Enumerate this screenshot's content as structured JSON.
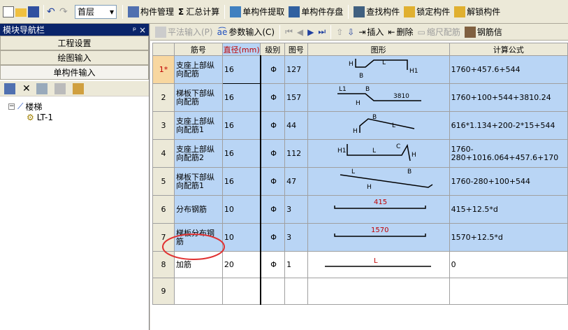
{
  "toolbar": {
    "floor": "首层",
    "items": [
      "构件管理",
      "汇总计算",
      "单构件提取",
      "单构件存盘",
      "查找构件",
      "锁定构件",
      "解锁构件"
    ]
  },
  "nav": {
    "title": "模块导航栏",
    "pin": "ᵖ × ",
    "sections": [
      "工程设置",
      "绘图输入",
      "单构件输入"
    ],
    "tree": {
      "root": "楼梯",
      "child": "LT-1"
    }
  },
  "toolbar2": {
    "items": [
      "平法输入(P)",
      "参数输入(C)",
      "插入",
      "删除",
      "缩尺配筋",
      "钢筋信"
    ]
  },
  "table": {
    "headers": [
      "",
      "筋号",
      "直径(mm)",
      "级别",
      "图号",
      "图形",
      "计算公式"
    ],
    "rows": [
      {
        "rn": "1*",
        "name": "支座上部纵向配筋",
        "diam": "16",
        "grade": "Φ",
        "fig": "127",
        "formula": "1760+457.6+544"
      },
      {
        "rn": "2",
        "name": "梯板下部纵向配筋",
        "diam": "16",
        "grade": "Φ",
        "fig": "157",
        "formula": "1760+100+544+3810.24"
      },
      {
        "rn": "3",
        "name": "支座上部纵向配筋1",
        "diam": "16",
        "grade": "Φ",
        "fig": "44",
        "formula": "616*1.134+200-2*15+544"
      },
      {
        "rn": "4",
        "name": "支座上部纵向配筋2",
        "diam": "16",
        "grade": "Φ",
        "fig": "112",
        "formula": "1760-280+1016.064+457.6+170"
      },
      {
        "rn": "5",
        "name": "梯板下部纵向配筋1",
        "diam": "16",
        "grade": "Φ",
        "fig": "47",
        "formula": "1760-280+100+544"
      },
      {
        "rn": "6",
        "name": "分布钢筋",
        "diam": "10",
        "grade": "Φ",
        "fig": "3",
        "formula": "415+12.5*d"
      },
      {
        "rn": "7",
        "name": "梯板分布钢筋",
        "diam": "10",
        "grade": "Φ",
        "fig": "3",
        "formula": "1570+12.5*d"
      },
      {
        "rn": "8",
        "name": "加筋",
        "diam": "20",
        "grade": "Φ",
        "fig": "1",
        "formula": "0"
      },
      {
        "rn": "9",
        "name": "",
        "diam": "",
        "grade": "",
        "fig": "",
        "formula": ""
      }
    ],
    "shape_labels": {
      "r1": [
        "H",
        "L",
        "H1",
        "B"
      ],
      "r2": [
        "L1",
        "B",
        "3810",
        "H"
      ],
      "r3": [
        "B",
        "H",
        "L"
      ],
      "r4": [
        "H1",
        "L",
        "C",
        "H"
      ],
      "r5": [
        "L",
        "B",
        "H"
      ],
      "r6": "415",
      "r7": "1570",
      "r8": "L"
    }
  },
  "colors": {
    "selected": "#b9d5f5",
    "accent": "#c00000",
    "annotation": "#e03030"
  }
}
